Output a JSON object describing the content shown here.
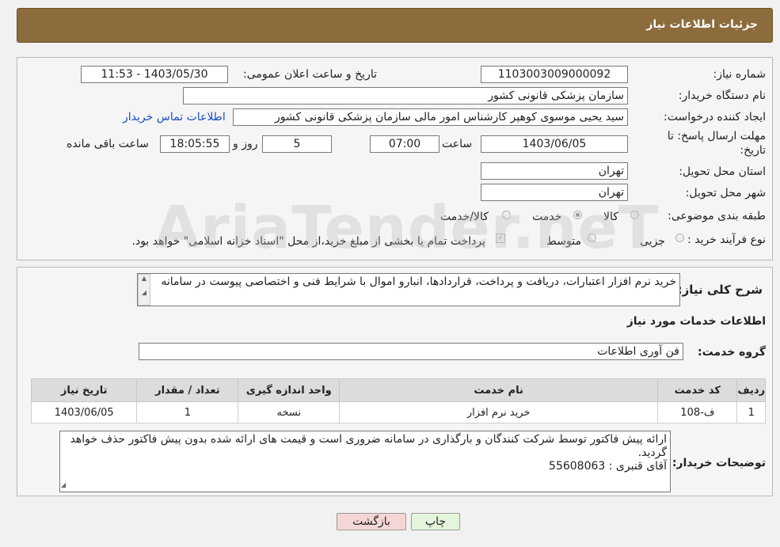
{
  "header": {
    "title": "جزئیات اطلاعات نیاز"
  },
  "details": {
    "need_number_label": "شماره نیاز:",
    "need_number": "1103003009000092",
    "announce_label": "تاریخ و ساعت اعلان عمومی:",
    "announce_value": "1403/05/30 - 11:53",
    "buyer_org_label": "نام دستگاه خریدار:",
    "buyer_org": "سازمان پزشکی قانونی کشور",
    "creator_label": "ایجاد کننده درخواست:",
    "creator": "سید یحیی موسوی کوهپر کارشناس امور مالی سازمان پزشکی قانونی کشور",
    "contact_link": "اطلاعات تماس خریدار",
    "deadline_label_1": "مهلت ارسال پاسخ: تا",
    "deadline_label_2": "تاریخ:",
    "deadline_date": "1403/06/05",
    "time_label": "ساعت",
    "deadline_time": "07:00",
    "days_value": "5",
    "days_label": "روز و",
    "remaining_time": "18:05:55",
    "remaining_label": "ساعت باقی مانده",
    "province_label": "استان محل تحویل:",
    "province": "تهران",
    "city_label": "شهر محل تحویل:",
    "city": "تهران",
    "category_label": "طبقه بندی موضوعی:",
    "category_options": [
      "کالا",
      "خدمت",
      "کالا/خدمت"
    ],
    "category_selected": "خدمت",
    "process_label": "نوع فرآیند خرید :",
    "process_options": [
      "جزیی",
      "متوسط"
    ],
    "payment_note": "پرداخت تمام یا بخشی از مبلغ خرید،از محل \"اسناد خزانه اسلامی\" خواهد بود."
  },
  "summary": {
    "label": "شرح کلی نیاز:",
    "text": "خرید نرم افزار اعتبارات، دریافت و پرداخت، قراردادها، انبارو اموال با شرایط فنی و اختصاصی  پیوست در سامانه"
  },
  "services": {
    "section_title": "اطلاعات خدمات مورد نیاز",
    "group_label": "گروه خدمت:",
    "group_value": "فن آوری اطلاعات",
    "columns": [
      "ردیف",
      "کد خدمت",
      "نام خدمت",
      "واحد اندازه گیری",
      "تعداد / مقدار",
      "تاریخ نیاز"
    ],
    "rows": [
      [
        "1",
        "ف-108",
        "خرید نرم افزار",
        "نسخه",
        "1",
        "1403/06/05"
      ]
    ]
  },
  "buyer_notes": {
    "label": "توضیحات خریدار:",
    "line1": "ارائه پیش فاکتور  توسط شرکت کنندگان و بارگذاری در سامانه ضروری است و قیمت های ارائه شده بدون پیش فاکتور حذف خواهد گردید.",
    "line3": "آقای قنبری :       55608063"
  },
  "buttons": {
    "print": "چاپ",
    "back": "بازگشت"
  },
  "watermark": "AriaTender.neT",
  "colors": {
    "header_bg": "#8c6c3c",
    "link": "#1a4cc8",
    "back_button": "#f5d6d6",
    "print_button": "#e4f5dc"
  }
}
